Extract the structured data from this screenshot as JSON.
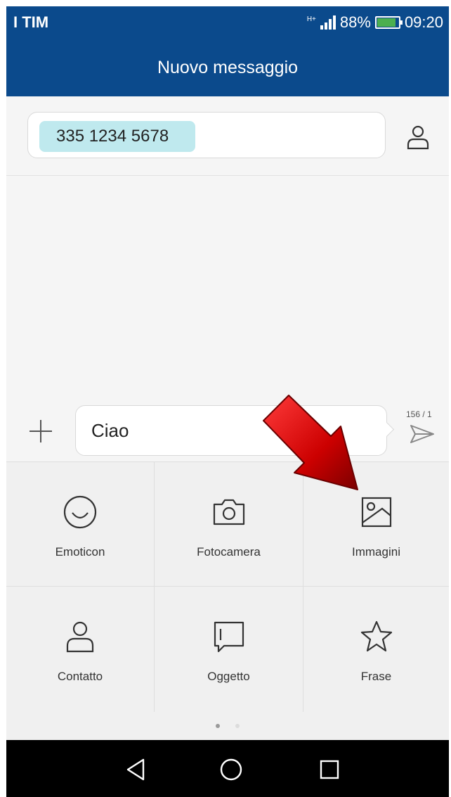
{
  "status_bar": {
    "carrier": "I TIM",
    "network": "H+",
    "battery_percent": "88%",
    "battery_level": 0.88,
    "time": "09:20"
  },
  "header": {
    "title": "Nuovo messaggio"
  },
  "recipient": {
    "chip": "335 1234 5678"
  },
  "composer": {
    "text": "Ciao",
    "counter": "156 / 1"
  },
  "attachments": [
    {
      "label": "Emoticon",
      "icon": "emoticon-icon"
    },
    {
      "label": "Fotocamera",
      "icon": "camera-icon"
    },
    {
      "label": "Immagini",
      "icon": "image-icon"
    },
    {
      "label": "Contatto",
      "icon": "contact-icon"
    },
    {
      "label": "Oggetto",
      "icon": "subject-icon"
    },
    {
      "label": "Frase",
      "icon": "star-icon"
    }
  ],
  "pager": {
    "pages": 2,
    "current": 1
  },
  "colors": {
    "header_bg": "#0b4a8c",
    "chip_bg": "#bfe9ee",
    "arrow": "#cc0000",
    "battery_fill": "#4caf50"
  }
}
